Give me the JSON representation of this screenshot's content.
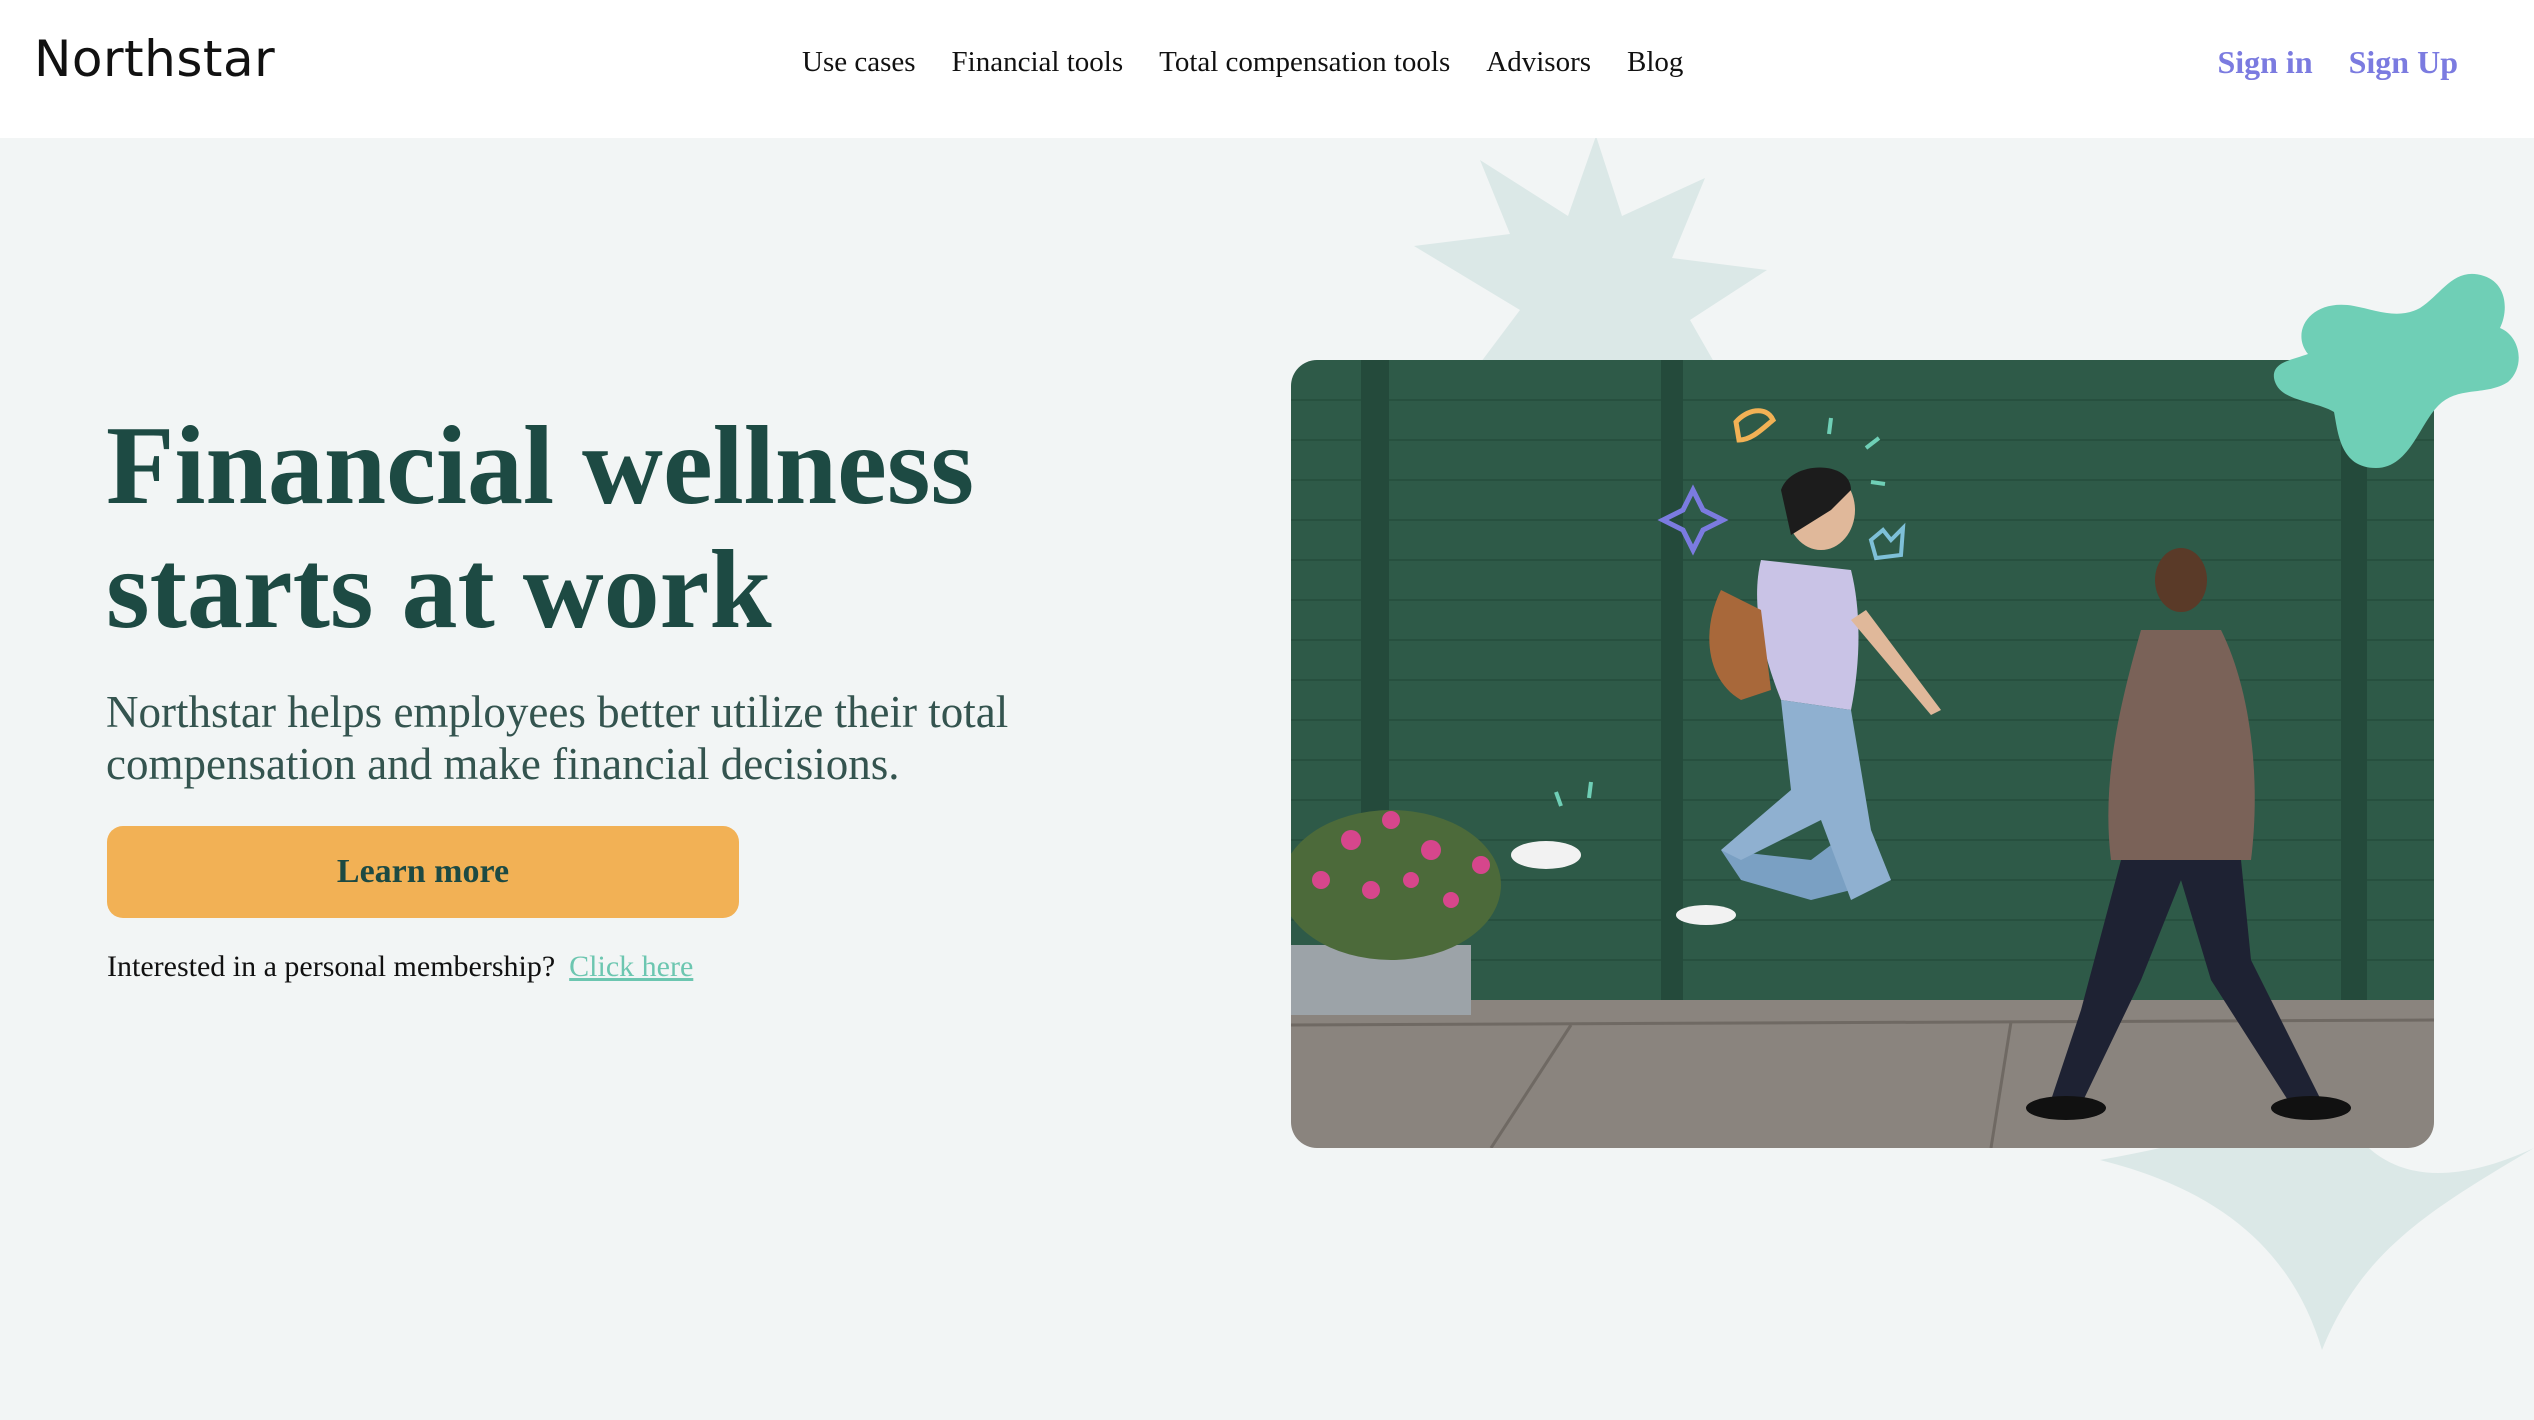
{
  "brand": {
    "logo_text": "Northstar"
  },
  "nav": {
    "items": [
      {
        "label": "Use cases"
      },
      {
        "label": "Financial tools"
      },
      {
        "label": "Total compensation tools"
      },
      {
        "label": "Advisors"
      },
      {
        "label": "Blog"
      }
    ]
  },
  "auth": {
    "sign_in": "Sign in",
    "sign_up": "Sign Up"
  },
  "hero": {
    "title_line1": "Financial wellness",
    "title_line2": "starts at work",
    "subtitle": "Northstar helps employees better utilize their total compensation and make financial decisions.",
    "cta_label": "Learn more",
    "membership_text": "Interested in a personal membership?",
    "membership_link": "Click here"
  },
  "colors": {
    "heading": "#1d4a43",
    "accent_orange": "#f2b155",
    "accent_teal": "#6cc6b0",
    "link_purple": "#7b7be0",
    "background": "#f2f5f5"
  }
}
